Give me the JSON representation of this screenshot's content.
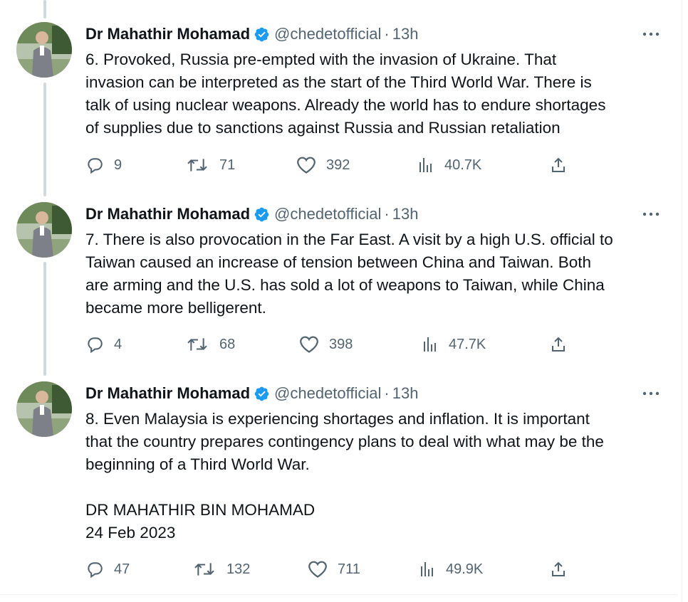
{
  "author": {
    "name": "Dr Mahathir Mohamad",
    "handle": "@chedetofficial",
    "separator": "·",
    "verified_color": "#1d9bf0"
  },
  "tweets": [
    {
      "time": "13h",
      "text": "6. Provoked, Russia pre-empted with the invasion of Ukraine. That\ninvasion can be interpreted as the start of the Third World War. There is\ntalk of using nuclear weapons. Already the world has to endure shortages\nof supplies due to sanctions against Russia and Russian retaliation",
      "replies": "9",
      "retweets": "71",
      "likes": "392",
      "views": "40.7K"
    },
    {
      "time": "13h",
      "text": "7. There is also provocation in the Far East. A visit by a high U.S. official to\nTaiwan caused an increase of tension between China and Taiwan. Both\nare arming and the U.S. has sold a lot of weapons to Taiwan, while China\nbecame more belligerent.",
      "replies": "4",
      "retweets": "68",
      "likes": "398",
      "views": "47.7K"
    },
    {
      "time": "13h",
      "text": "8. Even Malaysia is experiencing shortages and inflation. It is important\nthat the country prepares contingency plans to deal with what may be the\nbeginning of a Third World War.\n\nDR MAHATHIR BIN MOHAMAD\n24 Feb 2023",
      "replies": "47",
      "retweets": "132",
      "likes": "711",
      "views": "49.9K"
    }
  ],
  "icons": {
    "reply": "reply-icon",
    "retweet": "retweet-icon",
    "like": "like-icon",
    "views": "views-icon",
    "share": "share-icon",
    "more": "more-icon",
    "verified": "verified-icon"
  }
}
